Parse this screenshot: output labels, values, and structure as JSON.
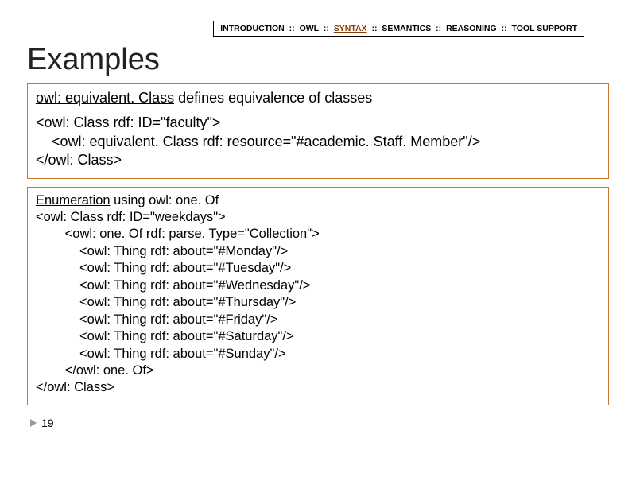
{
  "breadcrumb": {
    "items": [
      "INTRODUCTION",
      "OWL",
      "SYNTAX",
      "SEMANTICS",
      "REASONING",
      "TOOL SUPPORT"
    ],
    "separator": "::",
    "active_index": 2
  },
  "title": "Examples",
  "box1": {
    "lead_term": "owl: equivalent. Class",
    "lead_rest": " defines equivalence of classes",
    "code": [
      "<owl: Class rdf: ID=\"faculty\">",
      "    <owl: equivalent. Class rdf: resource=\"#academic. Staff. Member\"/>",
      "</owl: Class>"
    ]
  },
  "box2": {
    "lead_prefix": "Enumeration",
    "lead_rest": " using owl: one. Of",
    "code": [
      "<owl: Class rdf: ID=\"weekdays\">",
      "        <owl: one. Of rdf: parse. Type=\"Collection\">",
      "            <owl: Thing rdf: about=\"#Monday\"/>",
      "            <owl: Thing rdf: about=\"#Tuesday\"/>",
      "            <owl: Thing rdf: about=\"#Wednesday\"/>",
      "            <owl: Thing rdf: about=\"#Thursday\"/>",
      "            <owl: Thing rdf: about=\"#Friday\"/>",
      "            <owl: Thing rdf: about=\"#Saturday\"/>",
      "            <owl: Thing rdf: about=\"#Sunday\"/>",
      "        </owl: one. Of>",
      "</owl: Class>"
    ]
  },
  "page_number": "19"
}
